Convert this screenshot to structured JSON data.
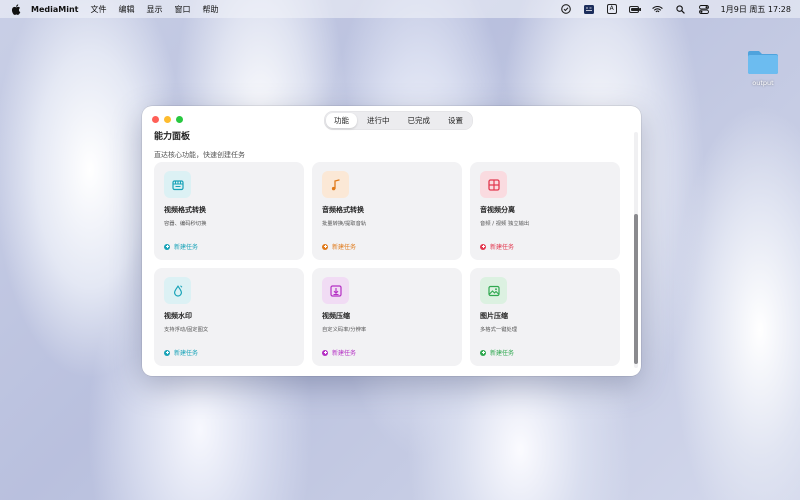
{
  "menubar": {
    "app_name": "MediaMint",
    "menus": [
      "文件",
      "编辑",
      "显示",
      "窗口",
      "帮助"
    ],
    "ime_label": "A",
    "datetime": "1月9日 周五  17:28"
  },
  "desktop": {
    "folder_label": "output"
  },
  "window": {
    "tabs": [
      {
        "label": "功能",
        "active": true
      },
      {
        "label": "进行中",
        "active": false
      },
      {
        "label": "已完成",
        "active": false
      },
      {
        "label": "设置",
        "active": false
      }
    ],
    "panel_title": "能力面板",
    "panel_subtitle": "直达核心功能，快速创建任务",
    "cards": [
      {
        "title": "视频格式转换",
        "desc": "容器、编码秒切换",
        "action": "新建任务",
        "icon": "video-convert-icon",
        "color": "#18a3b8",
        "bg": "#dcf1f4"
      },
      {
        "title": "音频格式转换",
        "desc": "批量转换/提取音轨",
        "action": "新建任务",
        "icon": "music-note-icon",
        "color": "#e07a1a",
        "bg": "#fbe8d6"
      },
      {
        "title": "音视频分离",
        "desc": "音频 / 视频 独立输出",
        "action": "新建任务",
        "icon": "split-grid-icon",
        "color": "#e2394f",
        "bg": "#fadbe0"
      },
      {
        "title": "视频水印",
        "desc": "支持浮动/固定图文",
        "action": "新建任务",
        "icon": "water-drop-icon",
        "color": "#18a3b8",
        "bg": "#dcf1f4"
      },
      {
        "title": "视频压缩",
        "desc": "自定义码率/分辨率",
        "action": "新建任务",
        "icon": "compress-down-icon",
        "color": "#b42fc4",
        "bg": "#f1dcf4"
      },
      {
        "title": "图片压缩",
        "desc": "多格式一键处理",
        "action": "新建任务",
        "icon": "image-icon",
        "color": "#2fa84f",
        "bg": "#dcf1e1"
      }
    ]
  }
}
